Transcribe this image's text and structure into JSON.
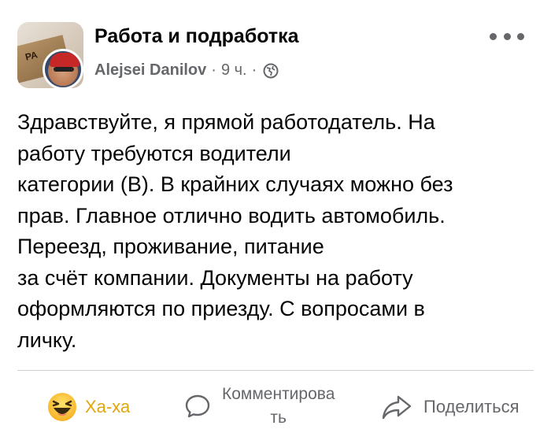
{
  "post": {
    "group_name": "Работа и подработка",
    "author": "Alejsei Danilov",
    "time": "9 ч.",
    "separator": "·",
    "privacy_icon": "globe-icon",
    "text_lines": [
      "Здравствуйте, я прямой работодатель. На",
      "работу требуются водители",
      "категории (В). В крайних случаях можно без",
      "прав. Главное отлично водить автомобиль.",
      "Переезд, проживание, питание",
      "за счёт компании. Документы на работу",
      "оформляются по приезду. С вопросами в",
      "личку."
    ],
    "group_avatar_text": "РА"
  },
  "actions": {
    "haha_label": "Ха-ха",
    "comment_label_line1": "Комментирова",
    "comment_label_line2": "ть",
    "share_label": "Поделиться"
  },
  "colors": {
    "primary_text": "#050505",
    "secondary_text": "#65676b",
    "haha_accent": "#e0a612",
    "divider": "#ced0d4"
  }
}
